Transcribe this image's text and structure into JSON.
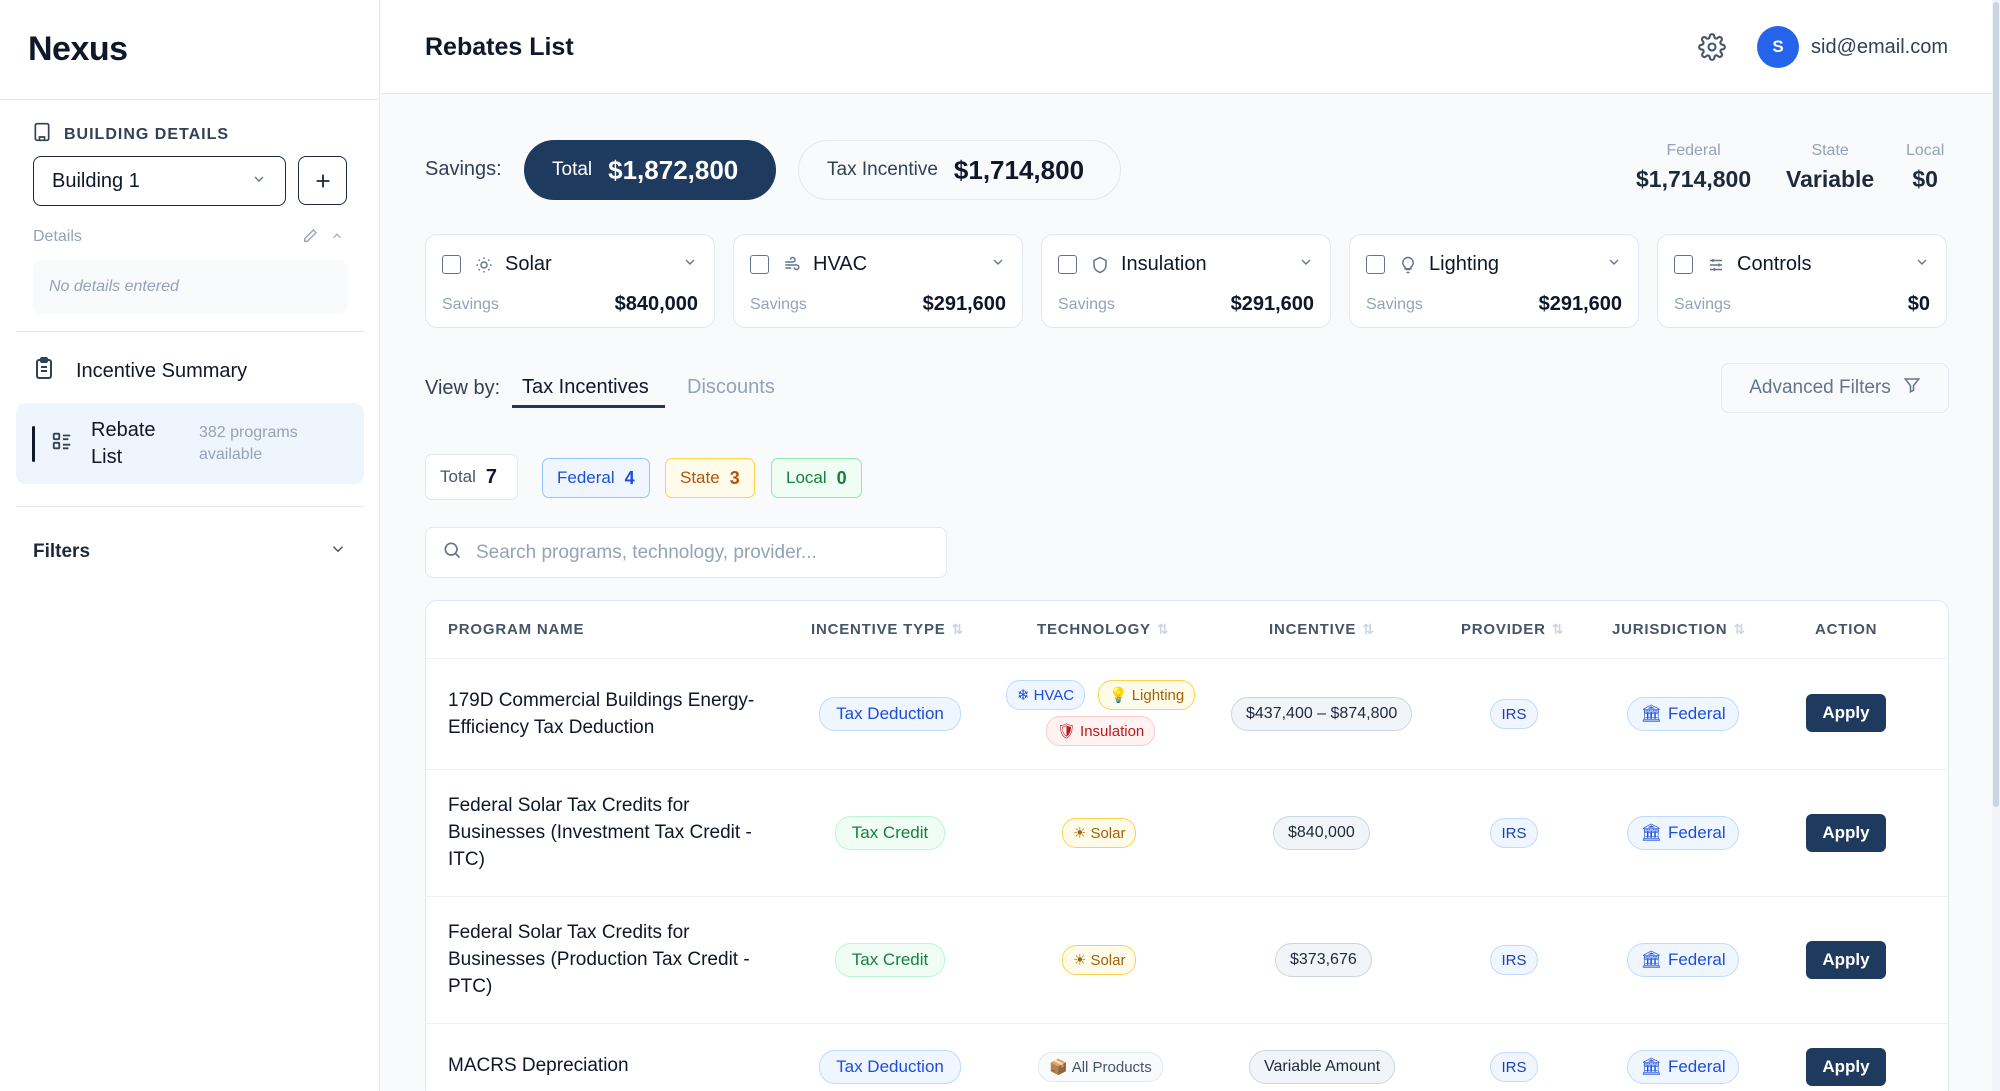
{
  "app": {
    "brand": "Nexus"
  },
  "sidebar": {
    "section_title": "BUILDING DETAILS",
    "building_select": "Building 1",
    "details_label": "Details",
    "details_placeholder": "No details entered",
    "nav": [
      {
        "label": "Incentive Summary"
      },
      {
        "label": "Rebate List",
        "meta": "382 programs available"
      }
    ],
    "filters_label": "Filters"
  },
  "header": {
    "title": "Rebates List",
    "user_initial": "S",
    "user_email": "sid@email.com"
  },
  "savings": {
    "label": "Savings:",
    "total_label": "Total",
    "total_value": "$1,872,800",
    "tax_label": "Tax Incentive",
    "tax_value": "$1,714,800",
    "jurisdictions": [
      {
        "label": "Federal",
        "value": "$1,714,800"
      },
      {
        "label": "State",
        "value": "Variable"
      },
      {
        "label": "Local",
        "value": "$0"
      }
    ]
  },
  "tech_cards": [
    {
      "name": "Solar",
      "icon": "sun-icon",
      "savings_label": "Savings",
      "savings": "$840,000"
    },
    {
      "name": "HVAC",
      "icon": "wind-icon",
      "savings_label": "Savings",
      "savings": "$291,600"
    },
    {
      "name": "Insulation",
      "icon": "shield-icon",
      "savings_label": "Savings",
      "savings": "$291,600"
    },
    {
      "name": "Lighting",
      "icon": "lightbulb-icon",
      "savings_label": "Savings",
      "savings": "$291,600"
    },
    {
      "name": "Controls",
      "icon": "sliders-icon",
      "savings_label": "Savings",
      "savings": "$0"
    }
  ],
  "view_by": {
    "label": "View by:",
    "tabs": [
      "Tax Incentives",
      "Discounts"
    ],
    "active": "Tax Incentives",
    "advanced_filters": "Advanced Filters"
  },
  "counts": {
    "total_label": "Total",
    "total": "7",
    "federal_label": "Federal",
    "federal": "4",
    "state_label": "State",
    "state": "3",
    "local_label": "Local",
    "local": "0"
  },
  "search": {
    "placeholder": "Search programs, technology, provider..."
  },
  "table": {
    "headers": [
      "PROGRAM NAME",
      "INCENTIVE TYPE",
      "TECHNOLOGY",
      "INCENTIVE",
      "PROVIDER",
      "JURISDICTION",
      "ACTION"
    ],
    "rows": [
      {
        "name": "179D Commercial Buildings Energy-Efficiency Tax Deduction",
        "type": "Tax Deduction",
        "tech": [
          "HVAC",
          "Lighting",
          "Insulation"
        ],
        "incentive": "$437,400 – $874,800",
        "provider": "IRS",
        "jurisdiction": "Federal",
        "action": "Apply"
      },
      {
        "name": "Federal Solar Tax Credits for Businesses (Investment Tax Credit - ITC)",
        "type": "Tax Credit",
        "tech": [
          "Solar"
        ],
        "incentive": "$840,000",
        "provider": "IRS",
        "jurisdiction": "Federal",
        "action": "Apply"
      },
      {
        "name": "Federal Solar Tax Credits for Businesses (Production Tax Credit - PTC)",
        "type": "Tax Credit",
        "tech": [
          "Solar"
        ],
        "incentive": "$373,676",
        "provider": "IRS",
        "jurisdiction": "Federal",
        "action": "Apply"
      },
      {
        "name": "MACRS Depreciation",
        "type": "Tax Deduction",
        "tech": [
          "All Products"
        ],
        "incentive": "Variable Amount",
        "provider": "IRS",
        "jurisdiction": "Federal",
        "action": "Apply"
      }
    ]
  }
}
